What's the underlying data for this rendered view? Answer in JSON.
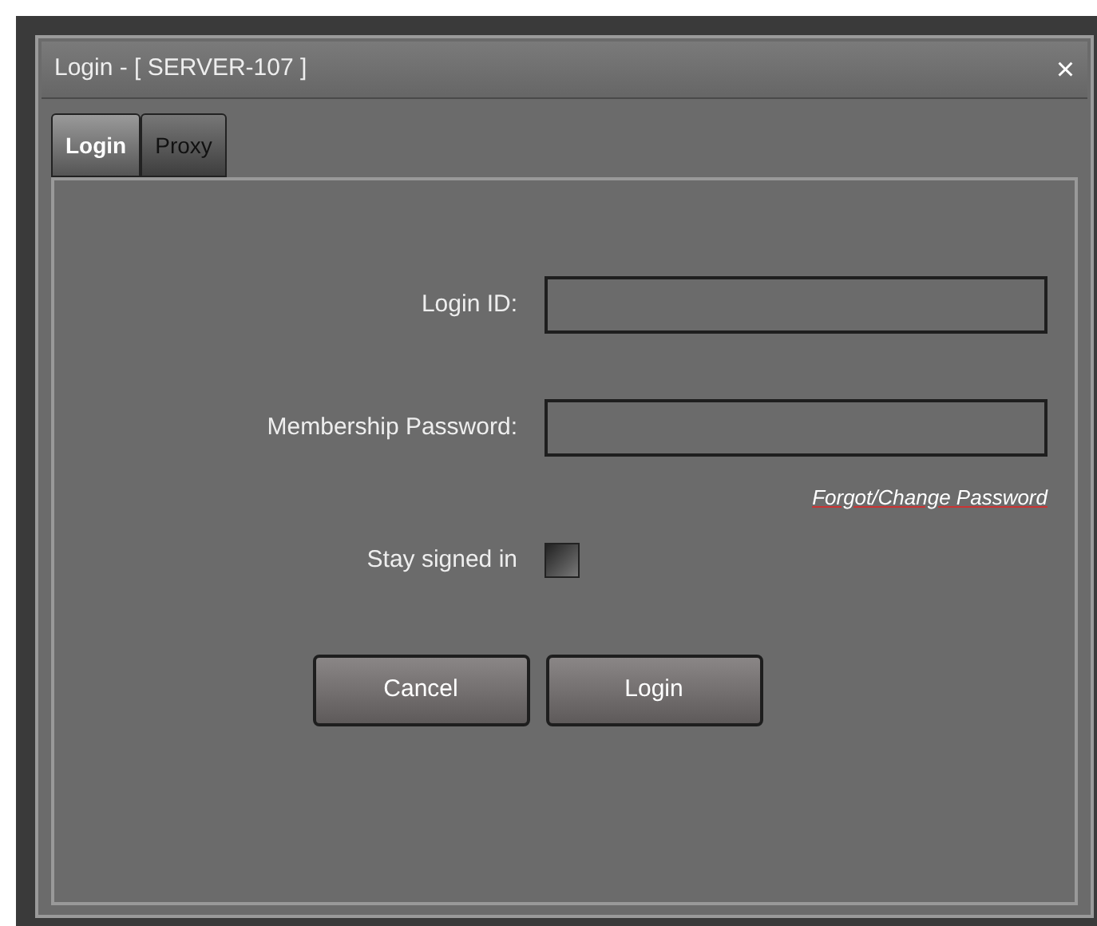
{
  "window": {
    "title": "Login - [ SERVER-107 ]",
    "close": "×"
  },
  "tabs": [
    {
      "label": "Login",
      "selected": true
    },
    {
      "label": "Proxy",
      "selected": false
    }
  ],
  "fields": [
    {
      "label": "Login ID:"
    },
    {
      "label": "Membership Password:"
    }
  ],
  "forgot_link": "Forgot/Change Password",
  "stay_signed_in": {
    "label": "Stay signed in",
    "checked": false
  },
  "buttons": [
    "Cancel",
    "Login"
  ]
}
